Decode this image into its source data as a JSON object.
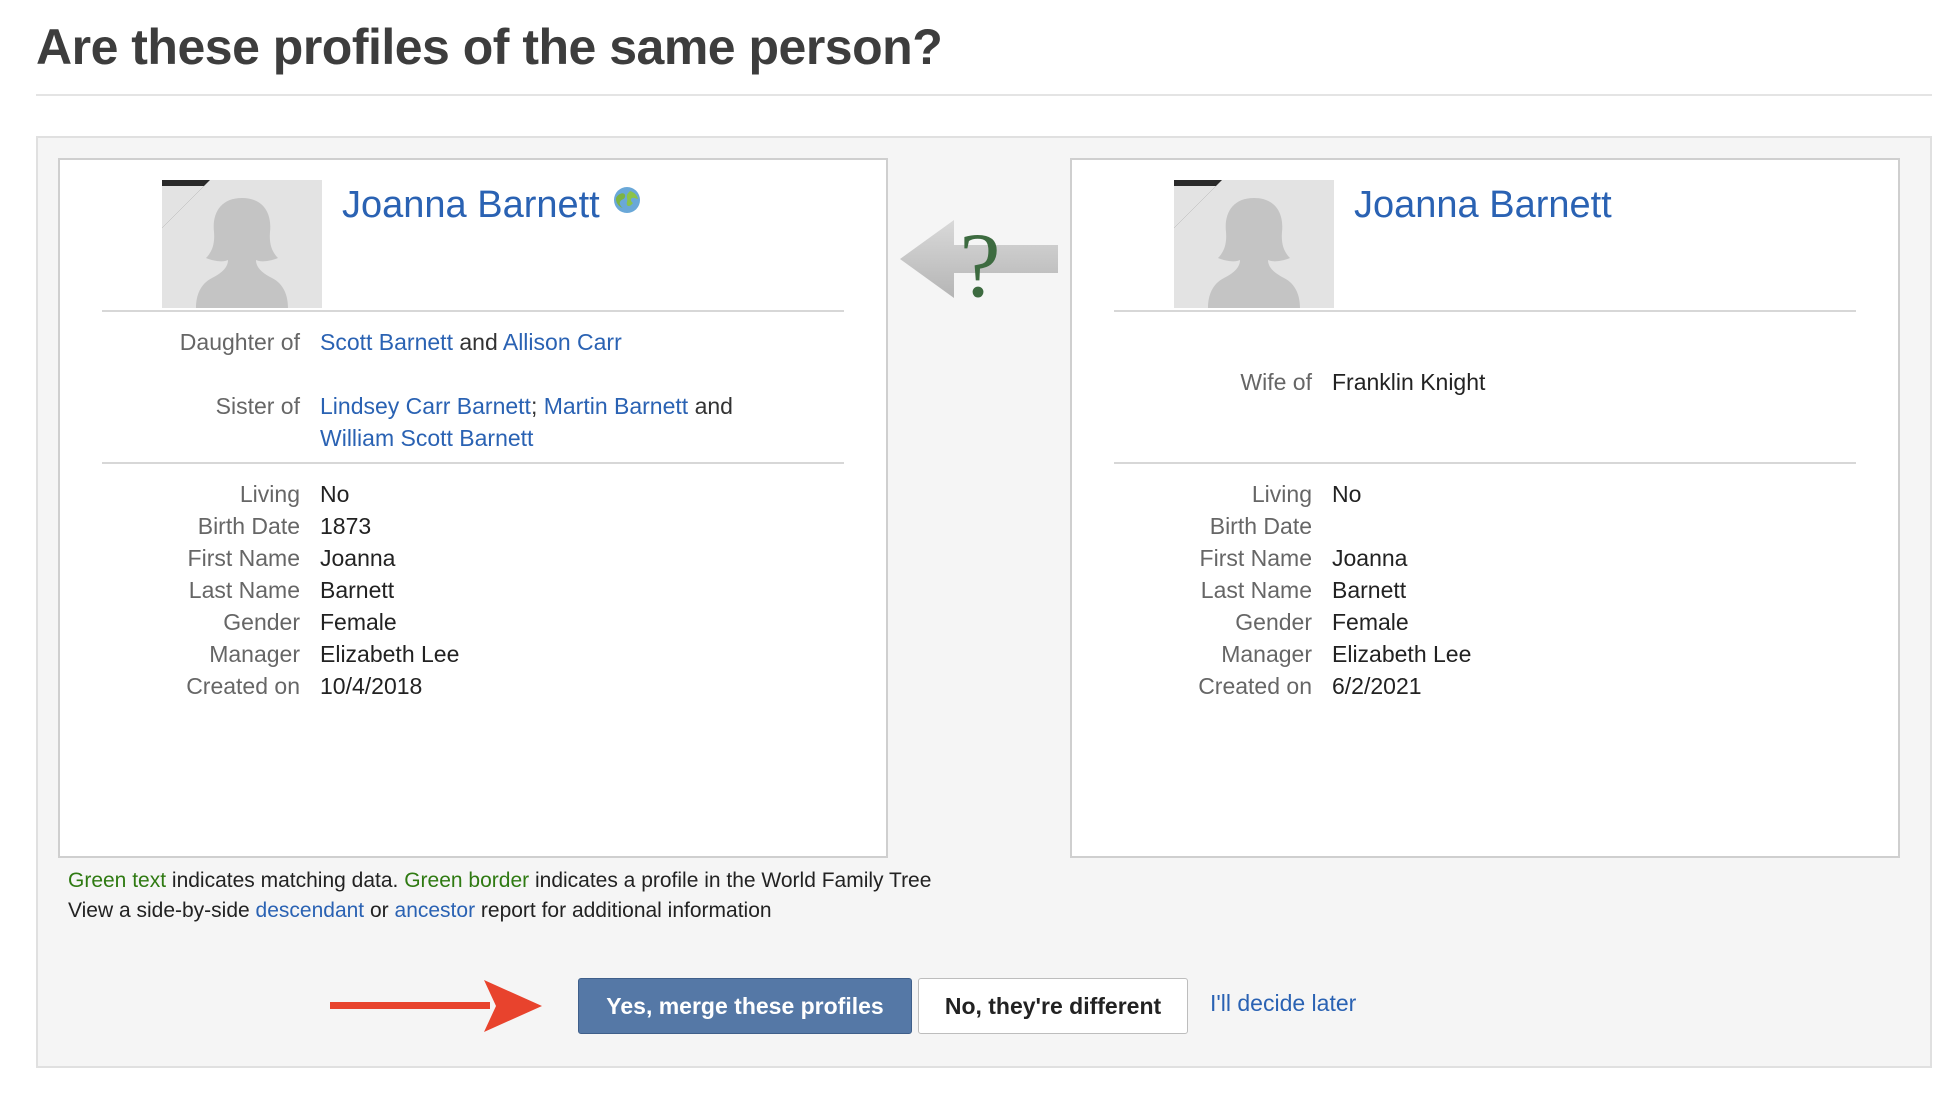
{
  "page": {
    "title": "Are these profiles of the same person?"
  },
  "left_profile": {
    "name": "Joanna Barnett",
    "daughter_of": {
      "label": "Daughter of",
      "parent1": "Scott Barnett",
      "and": "and",
      "parent2": "Allison Carr"
    },
    "sister_of": {
      "label": "Sister of",
      "sib1": "Lindsey Carr Barnett",
      "sep": ";",
      "sib2": "Martin Barnett",
      "and": "and",
      "sib3": "William Scott Barnett"
    },
    "fields": {
      "living_label": "Living",
      "living": "No",
      "birth_label": "Birth Date",
      "birth": "1873",
      "first_label": "First Name",
      "first": "Joanna",
      "last_label": "Last Name",
      "last": "Barnett",
      "gender_label": "Gender",
      "gender": "Female",
      "manager_label": "Manager",
      "manager": "Elizabeth Lee",
      "created_label": "Created on",
      "created": "10/4/2018"
    }
  },
  "right_profile": {
    "name": "Joanna Barnett",
    "wife_of": {
      "label": "Wife of",
      "spouse": "Franklin Knight"
    },
    "fields": {
      "living_label": "Living",
      "living": "No",
      "birth_label": "Birth Date",
      "birth": "",
      "first_label": "First Name",
      "first": "Joanna",
      "last_label": "Last Name",
      "last": "Barnett",
      "gender_label": "Gender",
      "gender": "Female",
      "manager_label": "Manager",
      "manager": "Elizabeth Lee",
      "created_label": "Created on",
      "created": "6/2/2021"
    }
  },
  "legend": {
    "green_text": "Green text",
    "matching": "indicates matching data.",
    "green_border": "Green border",
    "world_tree": "indicates a profile in the World Family Tree",
    "view_prefix": "View a side-by-side",
    "descendant": "descendant",
    "or": "or",
    "ancestor": "ancestor",
    "view_suffix": "report for additional information"
  },
  "actions": {
    "merge": "Yes, merge these profiles",
    "different": "No, they're different",
    "later": "I'll decide later"
  },
  "compare_symbol": "?",
  "colors": {
    "link": "#2a62b3",
    "match_green": "#2f7a12",
    "primary_button": "#5578a6",
    "annotation_arrow": "#e8432d"
  }
}
